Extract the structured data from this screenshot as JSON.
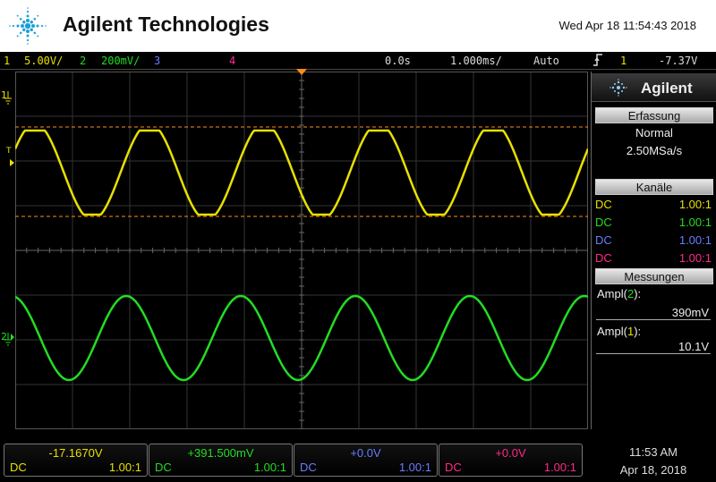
{
  "header": {
    "brand": "Agilent Technologies",
    "datetime": "Wed Apr 18 11:54:43 2018",
    "logo_icon": "agilent-spark-icon"
  },
  "statusbar": {
    "ch1_num": "1",
    "ch1_scale": "5.00V/",
    "ch2_num": "2",
    "ch2_scale": "200mV/",
    "ch3_num": "3",
    "ch4_num": "4",
    "time_offset": "0.0s",
    "time_scale": "1.000ms/",
    "trigger_mode": "Auto",
    "trigger_icon": "rising-edge-trigger-icon",
    "trigger_source": "1",
    "trigger_level": "-7.37V"
  },
  "display": {
    "ch1_marker": "1",
    "ch2_marker": "2",
    "trigger_marker": "T",
    "ch1_color": "#e8e000",
    "ch2_color": "#22dd22",
    "cursor_color": "#ff8c1a",
    "ch1_periods_per_screen": 5,
    "ch2_periods_per_screen": 5
  },
  "panel": {
    "brand": "Agilent",
    "acquisition_title": "Erfassung",
    "acquisition_mode": "Normal",
    "sample_rate": "2.50MSa/s",
    "channels_title": "Kanäle",
    "channels": [
      {
        "coupling": "DC",
        "ratio": "1.00:1",
        "color": "#e8e000"
      },
      {
        "coupling": "DC",
        "ratio": "1.00:1",
        "color": "#22dd22"
      },
      {
        "coupling": "DC",
        "ratio": "1.00:1",
        "color": "#6a7bff"
      },
      {
        "coupling": "DC",
        "ratio": "1.00:1",
        "color": "#ff2a8a"
      }
    ],
    "measurements_title": "Messungen",
    "meas1_label_prefix": "Ampl(",
    "meas1_channel": "2",
    "meas1_label_suffix": "):",
    "meas1_value": "390mV",
    "meas2_label_prefix": "Ampl(",
    "meas2_channel": "1",
    "meas2_label_suffix": "):",
    "meas2_value": "10.1V"
  },
  "bottombar": {
    "channels": [
      {
        "offset": "-17.1670V",
        "coupling": "DC",
        "ratio": "1.00:1"
      },
      {
        "offset": "+391.500mV",
        "coupling": "DC",
        "ratio": "1.00:1"
      },
      {
        "offset": "+0.0V",
        "coupling": "DC",
        "ratio": "1.00:1"
      },
      {
        "offset": "+0.0V",
        "coupling": "DC",
        "ratio": "1.00:1"
      }
    ],
    "clock_time": "11:53 AM",
    "clock_date": "Apr 18, 2018"
  }
}
